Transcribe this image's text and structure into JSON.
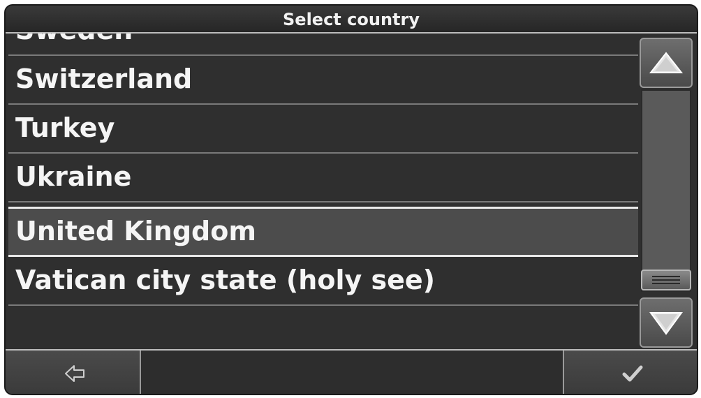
{
  "title": "Select country",
  "countries": [
    {
      "label": "Sweden"
    },
    {
      "label": "Switzerland"
    },
    {
      "label": "Turkey"
    },
    {
      "label": "Ukraine"
    },
    {
      "label": "United Kingdom",
      "selected": true
    },
    {
      "label": "Vatican city state (holy see)"
    }
  ],
  "scrollbar": {
    "up_icon": "triangle-up-icon",
    "down_icon": "triangle-down-icon"
  },
  "footer": {
    "back_icon": "back-arrow-icon",
    "confirm_icon": "checkmark-icon"
  }
}
